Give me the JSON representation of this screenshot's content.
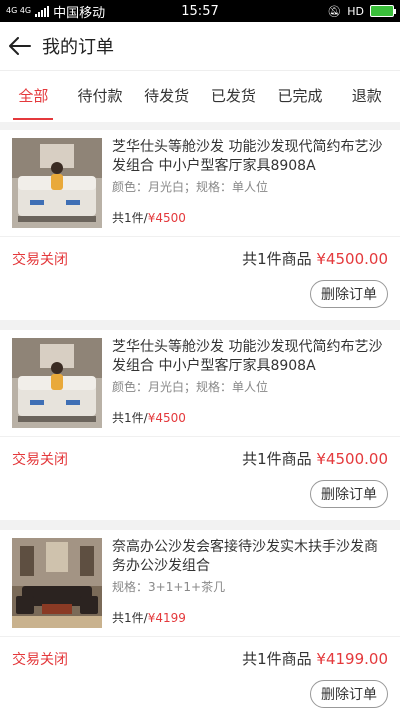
{
  "statusbar": {
    "network": "4G 4G",
    "carrier": "中国移动",
    "time": "15:57",
    "right_text": "HD"
  },
  "header": {
    "title": "我的订单"
  },
  "tabs": [
    {
      "label": "全部",
      "active": true
    },
    {
      "label": "待付款"
    },
    {
      "label": "待发货"
    },
    {
      "label": "已发货"
    },
    {
      "label": "已完成"
    },
    {
      "label": "退款"
    }
  ],
  "orders": [
    {
      "name": "芝华仕头等舱沙发 功能沙发现代简约布艺沙发组合 中小户型客厅家具8908A",
      "spec": "颜色：月光白；规格：单人位",
      "qty": "共1件/",
      "price": "¥4500",
      "status": "交易关闭",
      "total_label": "共1件商品",
      "total": "¥4500.00",
      "action": "删除订单"
    },
    {
      "name": "芝华仕头等舱沙发 功能沙发现代简约布艺沙发组合 中小户型客厅家具8908A",
      "spec": "颜色：月光白；规格：单人位",
      "qty": "共1件/",
      "price": "¥4500",
      "status": "交易关闭",
      "total_label": "共1件商品",
      "total": "¥4500.00",
      "action": "删除订单"
    },
    {
      "name": "奈高办公沙发会客接待沙发实木扶手沙发商务办公沙发组合",
      "spec": "规格：3+1+1+茶几",
      "qty": "共1件/",
      "price": "¥4199",
      "status": "交易关闭",
      "total_label": "共1件商品",
      "total": "¥4199.00",
      "action": "删除订单"
    }
  ]
}
